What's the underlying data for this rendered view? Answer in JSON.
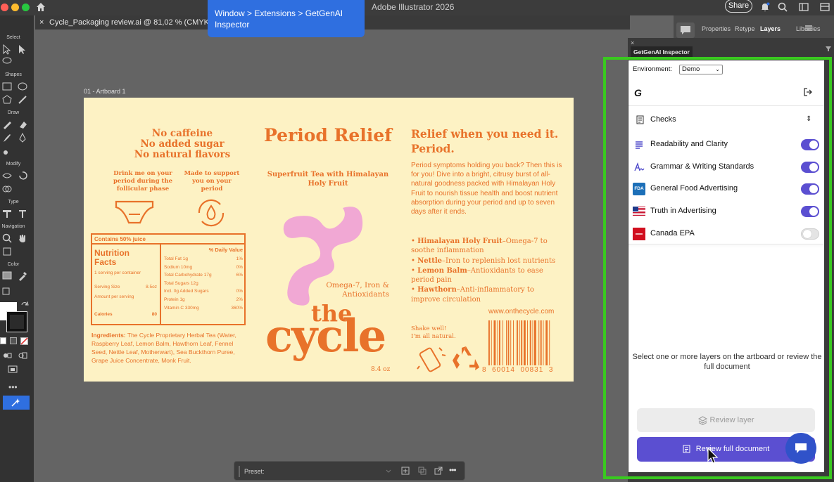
{
  "window": {
    "app_title": "Adobe Illustrator 2026",
    "share_label": "Share",
    "document_tab": "Cycle_Packaging review.ai @ 81,02 % (CMYK/Preview)",
    "tooltip": "Window > Extensions > GetGenAI Inspector"
  },
  "toolbar": {
    "groups": [
      "Select",
      "Shapes",
      "Draw",
      "Modify",
      "Type",
      "Navigation",
      "Color"
    ]
  },
  "artboard": {
    "label": "01 - Artboard 1",
    "claims": "No caffeine\nNo added sugar\nNo natural flavors",
    "drink_note": "Drink me on your period during the follicular phase",
    "support_note": "Made to support you on your period",
    "nutrition": {
      "header": "Contains 50% juice",
      "title": "Nutrition Facts",
      "serving_per": "1 serving per container",
      "serving_size_label": "Serving Size",
      "serving_size_value": "8.5oz",
      "amount_label": "Amount per serving",
      "calories_label": "Calories",
      "calories_value": "80",
      "dv_header": "% Daily Value",
      "rows": [
        {
          "name": "Total Fat 1g",
          "value": "1%"
        },
        {
          "name": "Sodium 10mg",
          "value": "0%"
        },
        {
          "name": "Total Carbohydrate 17g",
          "value": "6%"
        },
        {
          "name": "Total Sugars 12g",
          "value": ""
        },
        {
          "name": "Incl. 0g Added Sugars",
          "value": "0%"
        },
        {
          "name": "Protein 1g",
          "value": "2%"
        },
        {
          "name": "Vitamin C 330mg",
          "value": "360%"
        }
      ]
    },
    "ingredients_label": "Ingredients:",
    "ingredients": "The Cycle Proprietary Herbal Tea (Water, Raspberry Leaf, Lemon Balm, Hawthorn Leaf, Fennel Seed, Nettle Leaf, Motherwart), Sea Buckthorn Puree, Grape Juice Concentrate, Monk Fruit.",
    "product_title": "Period Relief",
    "product_sub": "Superfruit Tea with Himalayan Holy Fruit",
    "omega": "Omega-7, Iron & Antioxidants",
    "brand_the": "the",
    "brand_cycle": "cycle",
    "volume": "8.4 oz",
    "relief_heading": "Relief when you need it. Period.",
    "relief_body": "Period symptoms holding you back? Then this is for you! Dive into a bright, citrusy burst of all-natural goodness packed with Himalayan Holy Fruit to nourish tissue health and boost nutrient absorption during your period and up to seven days after it ends.",
    "bullets": [
      {
        "b": "Himalayan Holy Fruit",
        "t": "–Omega-7 to soothe inflammation"
      },
      {
        "b": "Nettle",
        "t": "–Iron to replenish lost nutrients"
      },
      {
        "b": "Lemon Balm",
        "t": "–Antioxidants to ease period pain"
      },
      {
        "b": "Hawthorn",
        "t": "–Anti-inflammatory to improve circulation"
      }
    ],
    "url": "www.onthecycle.com",
    "shake": "Shake well!\nI'm all natural.",
    "barcode_number": "8  60014  00831  3",
    "colors": {
      "orange": "#e8722a",
      "pink": "#f1a8d4",
      "cream": "#fdf2c4"
    }
  },
  "preset_bar": {
    "label": "Preset:"
  },
  "panels": {
    "tabs": [
      "Properties",
      "Retype",
      "Layers",
      "Libraries"
    ],
    "active_tab": "Layers",
    "plugin_tab": "GetGenAI Inspector"
  },
  "plugin": {
    "env_label": "Environment:",
    "env_value": "Demo",
    "logo": "G",
    "checks_label": "Checks",
    "checks": [
      {
        "label": "Readability and Clarity",
        "enabled": true,
        "icon": "lines-icon"
      },
      {
        "label": "Grammar & Writing Standards",
        "enabled": true,
        "icon": "grammar-icon"
      },
      {
        "label": "General Food Advertising",
        "enabled": true,
        "icon": "fda-logo-icon"
      },
      {
        "label": "Truth in Advertising",
        "enabled": true,
        "icon": "us-flag-icon"
      },
      {
        "label": "Canada EPA",
        "enabled": false,
        "icon": "canada-epa-icon"
      }
    ],
    "fda_text": "FDA",
    "hint": "Select one or more layers on the artboard or review the full document",
    "review_layer": "Review layer",
    "review_full": "Review full document",
    "accent": "#5b4fd1",
    "highlight": "#39c91f"
  }
}
